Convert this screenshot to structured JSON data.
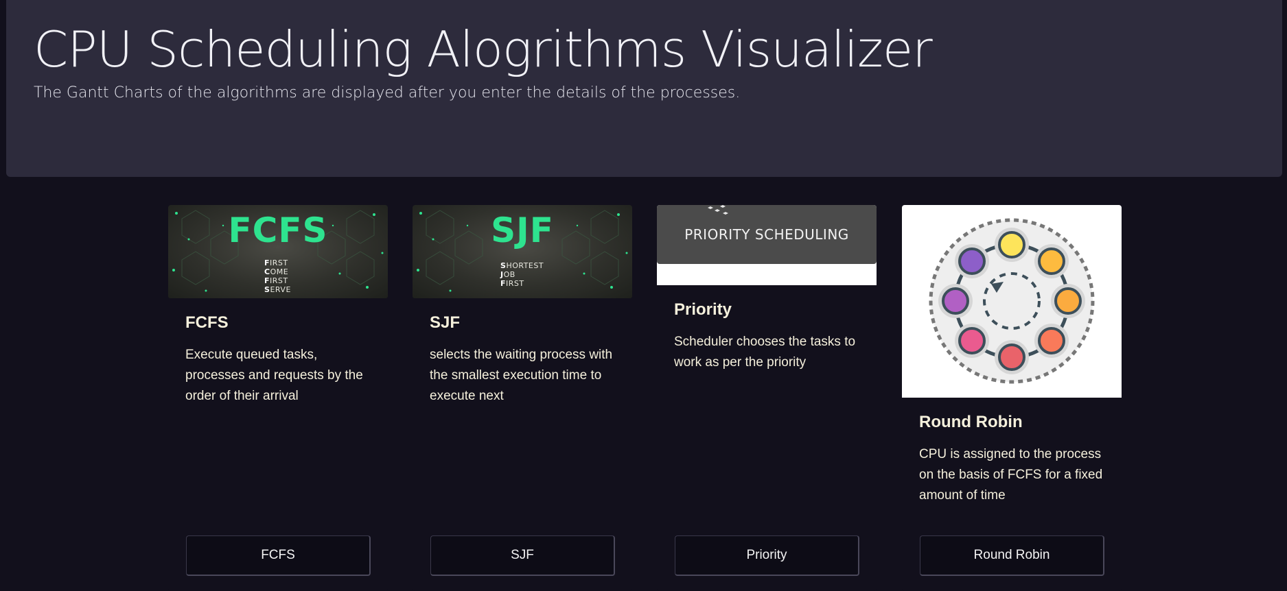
{
  "header": {
    "title": "CPU Scheduling Alogrithms Visualizer",
    "subtitle": "The Gantt Charts of the algorithms are displayed after you enter the details of the processes."
  },
  "cards": [
    {
      "image": {
        "type": "fcfs-banner",
        "big_text": "FCFS",
        "acronym": [
          {
            "initial": "F",
            "rest": "IRST"
          },
          {
            "initial": "C",
            "rest": "OME"
          },
          {
            "initial": "F",
            "rest": "IRST"
          },
          {
            "initial": "S",
            "rest": "ERVE"
          }
        ]
      },
      "title": "FCFS",
      "text": "Execute queued tasks, processes and requests by the order of their arrival",
      "button": "FCFS"
    },
    {
      "image": {
        "type": "sjf-banner",
        "big_text": "SJF",
        "acronym": [
          {
            "initial": "S",
            "rest": "HORTEST"
          },
          {
            "initial": "J",
            "rest": "OB"
          },
          {
            "initial": "F",
            "rest": "IRST"
          }
        ]
      },
      "title": "SJF",
      "text": "selects the waiting process with the smallest execution time to execute next",
      "button": "SJF"
    },
    {
      "image": {
        "type": "priority-banner",
        "caption": "PRIORITY SCHEDULING"
      },
      "title": "Priority",
      "text": "Scheduler chooses the tasks to work as per the priority",
      "button": "Priority"
    },
    {
      "image": {
        "type": "round-robin-diagram",
        "node_colors": [
          "#fde45b",
          "#fdbb3f",
          "#fbab3f",
          "#f97a5a",
          "#e9636a",
          "#ea5b8f",
          "#b160c4",
          "#8d5fc9"
        ]
      },
      "title": "Round Robin",
      "text": "CPU is assigned to the process on the basis of FCFS for a fixed amount of time",
      "button": "Round Robin"
    }
  ],
  "colors": {
    "page_background": "#12101c",
    "header_background": "#2d2b3c",
    "accent_green": "#2ee38f",
    "card_text": "#f5f0dc"
  }
}
